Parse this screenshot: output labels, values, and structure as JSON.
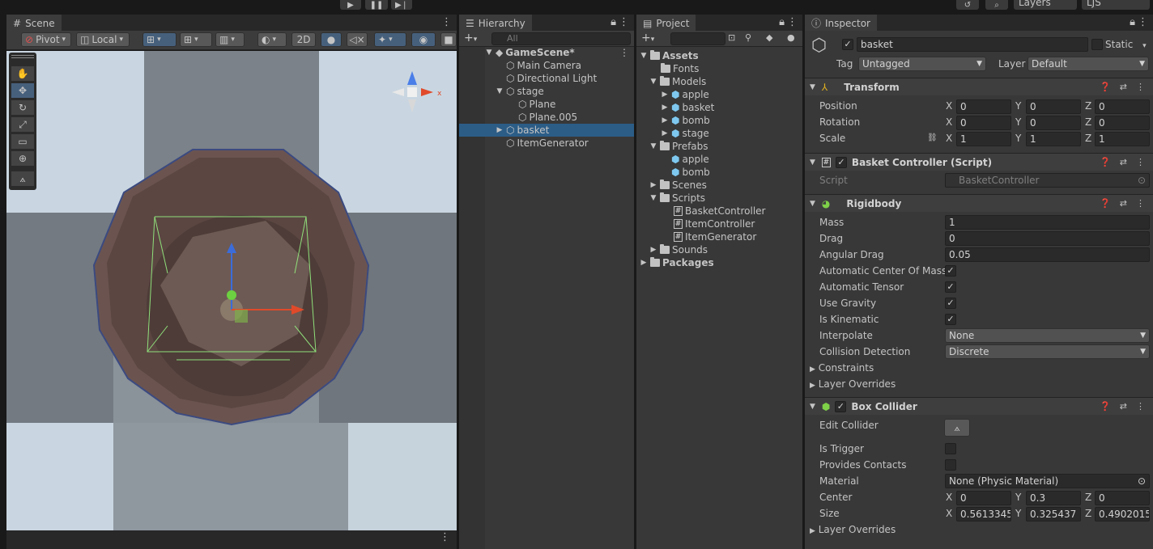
{
  "topbar": {
    "play_icon": "play-icon",
    "pause_icon": "pause-icon",
    "step_icon": "step-icon",
    "layers_label": "Layers",
    "account_label": "LJS"
  },
  "scene": {
    "tab": "Scene",
    "pivot_label": "Pivot",
    "local_label": "Local",
    "mode_2d": "2D"
  },
  "hierarchy": {
    "tab": "Hierarchy",
    "search_placeholder": "All",
    "scene_name": "GameScene*",
    "items": [
      {
        "label": "Main Camera"
      },
      {
        "label": "Directional Light"
      },
      {
        "label": "stage"
      },
      {
        "label": "Plane"
      },
      {
        "label": "Plane.005"
      },
      {
        "label": "basket"
      },
      {
        "label": "ItemGenerator"
      }
    ]
  },
  "project": {
    "tab": "Project",
    "items": [
      {
        "label": "Assets"
      },
      {
        "label": "Fonts"
      },
      {
        "label": "Models"
      },
      {
        "label": "apple"
      },
      {
        "label": "basket"
      },
      {
        "label": "bomb"
      },
      {
        "label": "stage"
      },
      {
        "label": "Prefabs"
      },
      {
        "label": "apple"
      },
      {
        "label": "bomb"
      },
      {
        "label": "Scenes"
      },
      {
        "label": "Scripts"
      },
      {
        "label": "BasketController"
      },
      {
        "label": "ItemController"
      },
      {
        "label": "ItemGenerator"
      },
      {
        "label": "Sounds"
      },
      {
        "label": "Packages"
      }
    ]
  },
  "inspector": {
    "tab": "Inspector",
    "object_name": "basket",
    "static_label": "Static",
    "tag_label": "Tag",
    "tag_value": "Untagged",
    "layer_label": "Layer",
    "layer_value": "Default",
    "transform": {
      "title": "Transform",
      "position_label": "Position",
      "rotation_label": "Rotation",
      "scale_label": "Scale",
      "position": [
        "0",
        "0",
        "0"
      ],
      "rotation": [
        "0",
        "0",
        "0"
      ],
      "scale": [
        "1",
        "1",
        "1"
      ]
    },
    "basket_controller": {
      "title": "Basket Controller (Script)",
      "script_label": "Script",
      "script_value": "BasketController"
    },
    "rigidbody": {
      "title": "Rigidbody",
      "mass_label": "Mass",
      "mass": "1",
      "drag_label": "Drag",
      "drag": "0",
      "angular_drag_label": "Angular Drag",
      "angular_drag": "0.05",
      "auto_com_label": "Automatic Center Of Mass",
      "auto_tensor_label": "Automatic Tensor",
      "gravity_label": "Use Gravity",
      "kinematic_label": "Is Kinematic",
      "interpolate_label": "Interpolate",
      "interpolate": "None",
      "collision_label": "Collision Detection",
      "collision": "Discrete",
      "constraints_label": "Constraints",
      "layer_overrides_label": "Layer Overrides"
    },
    "box_collider": {
      "title": "Box Collider",
      "edit_label": "Edit Collider",
      "trigger_label": "Is Trigger",
      "contacts_label": "Provides Contacts",
      "material_label": "Material",
      "material": "None (Physic Material)",
      "center_label": "Center",
      "center": [
        "0",
        "0.3",
        "0"
      ],
      "size_label": "Size",
      "size": [
        "0.5613345",
        "0.325437",
        "0.4902015"
      ],
      "layer_overrides_label": "Layer Overrides"
    },
    "axes": [
      "X",
      "Y",
      "Z"
    ]
  },
  "colors": {
    "selection": "#2c5d87",
    "panel": "#383838",
    "toggle_on": "#46607c"
  }
}
